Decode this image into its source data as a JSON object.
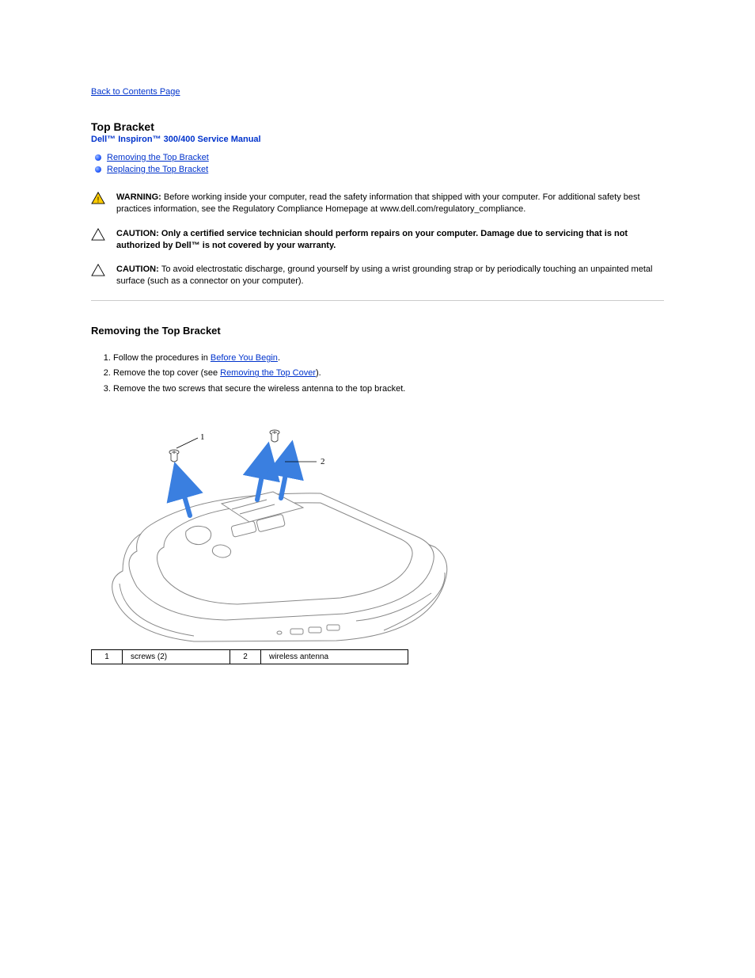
{
  "nav": {
    "back_label": "Back to Contents Page"
  },
  "header": {
    "title": "Top Bracket",
    "product": "Dell™ Inspiron™ 300/400 Service Manual"
  },
  "toc": {
    "items": [
      {
        "label": "Removing the Top Bracket"
      },
      {
        "label": "Replacing the Top Bracket"
      }
    ]
  },
  "notices": {
    "warning_prefix": "WARNING: ",
    "warning_text": "Before working inside your computer, read the safety information that shipped with your computer. For additional safety best practices information, see the Regulatory Compliance Homepage at www.dell.com/regulatory_compliance.",
    "caution1_prefix": "CAUTION: ",
    "caution1_bold": "Only a certified service technician should perform repairs on your computer. Damage due to servicing that is not authorized by Dell™ is not covered by your warranty.",
    "caution2_prefix": "CAUTION: ",
    "caution2_text": "To avoid electrostatic discharge, ground yourself by using a wrist grounding strap or by periodically touching an unpainted metal surface (such as a connector on your computer)."
  },
  "section": {
    "heading": "Removing the Top Bracket",
    "steps": {
      "s1_a": "Follow the procedures in ",
      "s1_link": "Before You Begin",
      "s1_b": ".",
      "s2_a": "Remove the top cover (see ",
      "s2_link": "Removing the Top Cover",
      "s2_b": ").",
      "s3": "Remove the two screws that secure the wireless antenna to the top bracket."
    }
  },
  "diagram": {
    "callouts": {
      "one": "1",
      "two": "2"
    },
    "legend": {
      "r1n": "1",
      "r1t": "screws (2)",
      "r2n": "2",
      "r2t": "wireless antenna"
    }
  }
}
